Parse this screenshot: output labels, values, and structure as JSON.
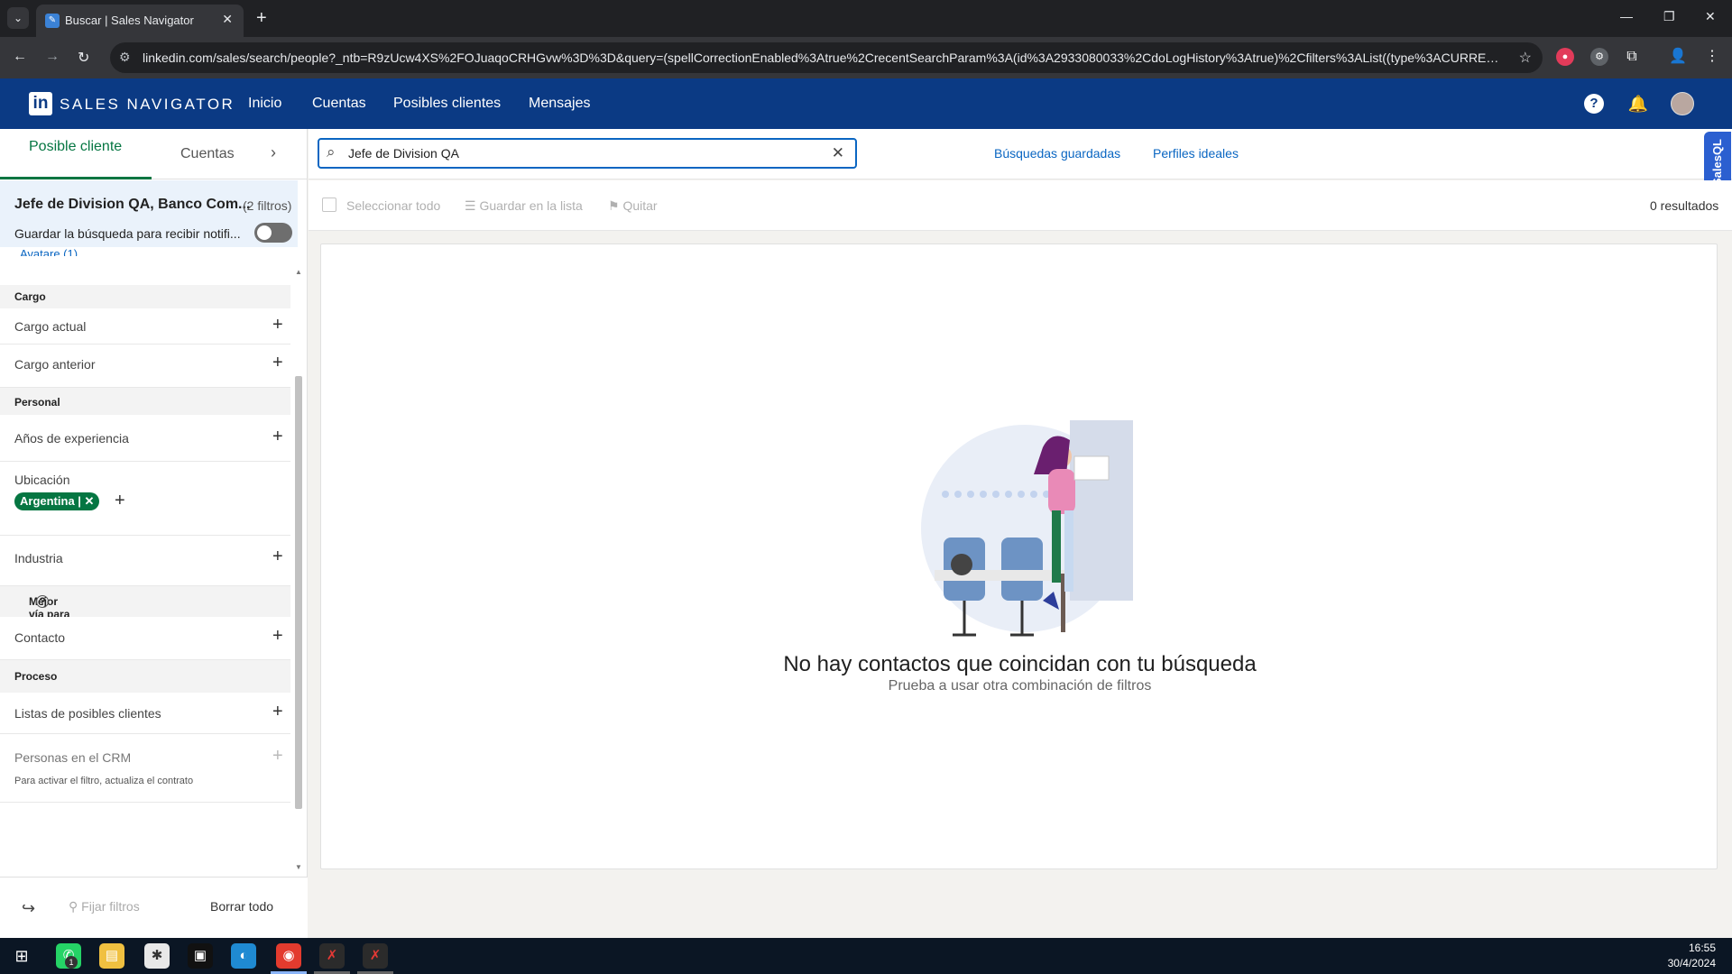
{
  "browser": {
    "tab_title": "Buscar | Sales Navigator",
    "url": "linkedin.com/sales/search/people?_ntb=R9zUcw4XS%2FOJuaqoCRHGvw%3D%3D&query=(spellCorrectionEnabled%3Atrue%2CrecentSearchParam%3A(id%3A2933080033%2CdoLogHistory%3Atrue)%2Cfilters%3AList((type%3ACURRENT_COMP..."
  },
  "header": {
    "brand": "SALES NAVIGATOR",
    "nav": [
      "Inicio",
      "Cuentas",
      "Posibles clientes",
      "Mensajes"
    ]
  },
  "sidebar": {
    "tab_active": "Posible cliente",
    "tab_other": "Cuentas",
    "search_title": "Jefe de Division QA, Banco Com...",
    "filter_count": "(2 filtros)",
    "save_search_label": "Guardar la búsqueda para recibir notifi...",
    "partial_item": "Avatare (1)",
    "sections": {
      "cargo": "Cargo",
      "personal": "Personal",
      "mejor_via": "Mejor vía para conectar",
      "proceso": "Proceso"
    },
    "filters": {
      "cargo_actual": "Cargo actual",
      "cargo_anterior": "Cargo anterior",
      "anos_experiencia": "Años de experiencia",
      "ubicacion": "Ubicación",
      "ubicacion_value": "Argentina",
      "industria": "Industria",
      "contacto": "Contacto",
      "listas": "Listas de posibles clientes",
      "crm": "Personas en el CRM",
      "crm_note": "Para activar el filtro, actualiza el contrato"
    },
    "footer": {
      "pin_label": "Fijar filtros",
      "clear_label": "Borrar todo"
    }
  },
  "main": {
    "search_value": "Jefe de Division QA",
    "saved_searches": "Búsquedas guardadas",
    "ideal_profiles": "Perfiles ideales",
    "select_all": "Seleccionar todo",
    "save_to_list": "Guardar en la lista",
    "remove": "Quitar",
    "results": "0 resultados",
    "empty_title": "No hay contactos que coincidan con tu búsqueda",
    "empty_subtitle": "Prueba a usar otra combinación de filtros"
  },
  "extension": {
    "label": "SalesQL"
  },
  "taskbar": {
    "time": "16:55",
    "date": "30/4/2024",
    "badge": "1"
  },
  "colors": {
    "linkedin_blue": "#0b3a84",
    "link_blue": "#0a66c2",
    "active_green": "#057642"
  }
}
